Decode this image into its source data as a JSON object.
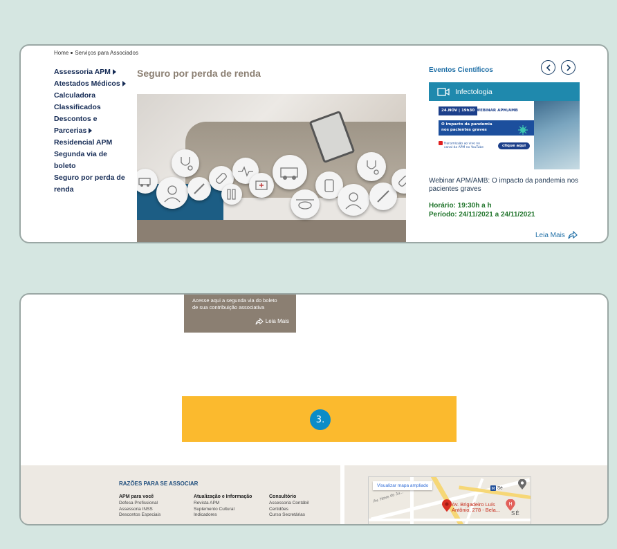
{
  "breadcrumb": {
    "home": "Home",
    "current": "Serviços para Associados"
  },
  "sidebar": {
    "items": [
      {
        "label": "Assessoria APM",
        "has_submenu": true
      },
      {
        "label": "Atestados Médicos",
        "has_submenu": true
      },
      {
        "label": "Calculadora",
        "has_submenu": false
      },
      {
        "label": "Classificados",
        "has_submenu": false
      },
      {
        "label": "Descontos e Parcerias",
        "has_submenu": true
      },
      {
        "label": "Residencial APM",
        "has_submenu": false
      },
      {
        "label": "Segunda via de boleto",
        "has_submenu": false
      },
      {
        "label": "Seguro por perda de",
        "has_submenu": false
      },
      {
        "label": "renda",
        "has_submenu": false
      }
    ]
  },
  "main": {
    "title": "Seguro por perda de renda"
  },
  "events": {
    "title": "Eventos Científicos",
    "card": {
      "category": "Infectologia",
      "image": {
        "date": "24.NOV | 19h30",
        "tag": "WEBINAR APM/AMB",
        "topic_line1": "O impacto da pandemia",
        "topic_line2": "nos pacientes graves",
        "live_line1": "Transmissão ao vivo no",
        "live_line2": "canal da APM no YouTube",
        "cta": "clique aqui"
      }
    },
    "description": "Webinar APM/AMB: O impacto da pandemia nos pacientes graves",
    "horario": "Horário: 19:30h a h",
    "periodo": "Período: 24/11/2021 a 24/11/2021",
    "more": "Leia Mais"
  },
  "boleto": {
    "line1": "Acesse aqui a segunda via do boleto",
    "line2": "de sua contribuição associativa",
    "more": "Leia Mais"
  },
  "banner": {
    "number": "3."
  },
  "footer": {
    "title": "RAZÕES PARA SE ASSOCIAR",
    "columns": [
      {
        "heading": "APM para você",
        "items": [
          "Defesa Profissional",
          "Assessoria INSS",
          "Descontos Especiais"
        ]
      },
      {
        "heading": "Atualização e Informação",
        "items": [
          "Revista APM",
          "Suplemento Cultural",
          "Indicadores"
        ]
      },
      {
        "heading": "Consultório",
        "items": [
          "Assessoria Contábil",
          "Certidões",
          "Curso Secretárias"
        ]
      }
    ]
  },
  "map": {
    "expand": "Visualizar mapa ampliado",
    "address_line1": "Av. Brigadeiro Luís",
    "address_line2": "Antônio, 278 - Bela...",
    "district": "SÉ",
    "metro": "Sé",
    "street": "Av. Nove de Ju..."
  },
  "colors": {
    "background": "#d5e6e1",
    "nav_text": "#142a54",
    "title_taupe": "#8b7f72",
    "event_header": "#1f89ad",
    "green_meta": "#21752c",
    "banner_yellow": "#fbba2e",
    "banner_badge": "#0b8cc7"
  }
}
